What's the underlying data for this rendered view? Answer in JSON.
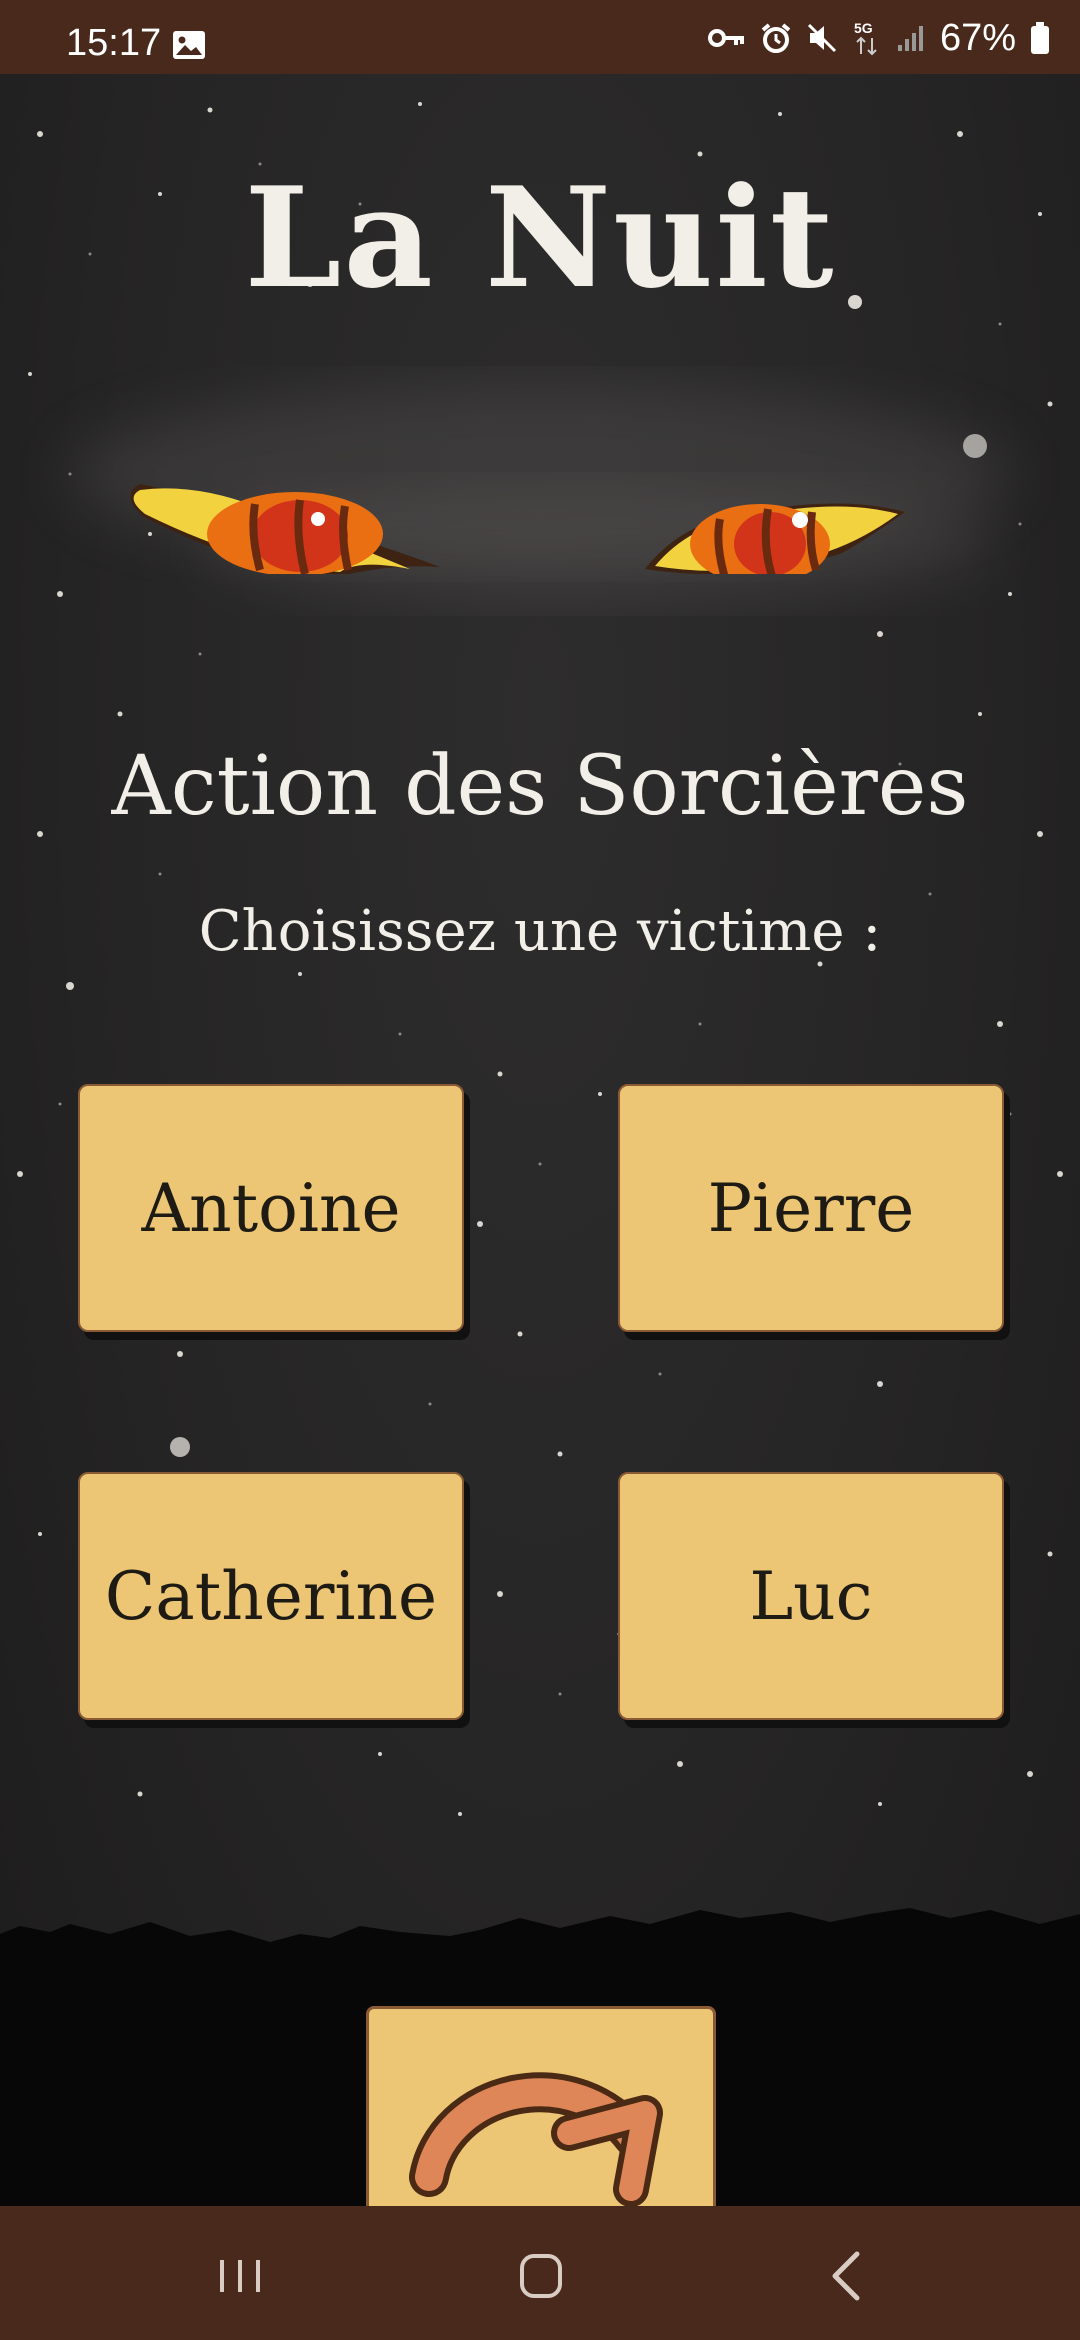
{
  "status_bar": {
    "time": "15:17",
    "battery": "67%",
    "network": "5G",
    "icons": [
      "image-icon",
      "key-icon",
      "alarm-icon",
      "mute-icon",
      "signal-icon",
      "battery-icon"
    ]
  },
  "screen": {
    "title": "La Nuit",
    "heading": "Action des Sorcières",
    "prompt": "Choisissez une victime :"
  },
  "choices": [
    {
      "label": "Antoine"
    },
    {
      "label": "Pierre"
    },
    {
      "label": "Catherine"
    },
    {
      "label": "Luc"
    }
  ],
  "actions": {
    "refresh_icon": "refresh-icon"
  },
  "nav_bar": {
    "icons": [
      "recent-apps-icon",
      "home-icon",
      "back-icon"
    ]
  },
  "colors": {
    "bar_brown": "#48291b",
    "card_gold": "#ecc674",
    "night_sky": "#262525",
    "text_light": "#f2efe8"
  }
}
